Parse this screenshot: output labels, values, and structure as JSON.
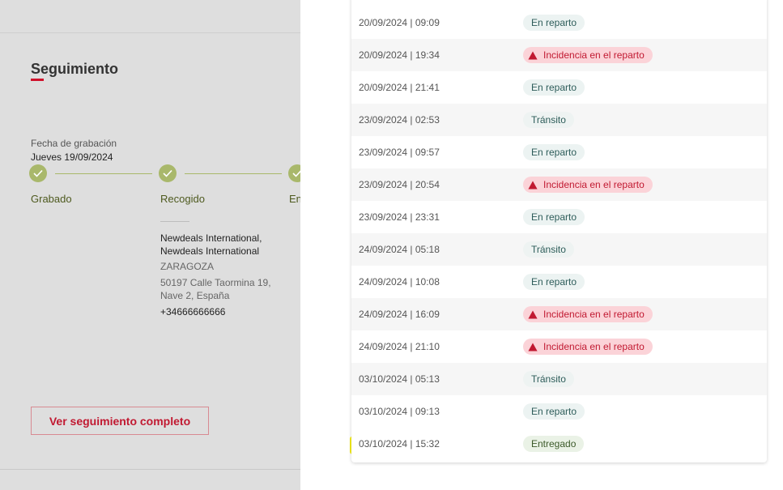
{
  "tracking": {
    "title": "Seguimiento",
    "fecha_label": "Fecha de grabación",
    "fecha_value": "Jueves 19/09/2024",
    "steps": [
      {
        "label": "Grabado"
      },
      {
        "label": "Recogido"
      },
      {
        "label": "En"
      }
    ],
    "address": {
      "name_line1": "Newdeals International,",
      "name_line2": "Newdeals International",
      "city": "ZARAGOZA",
      "street_line1": "50197 Calle Taormina 19,",
      "street_line2": "Nave 2, España",
      "phone": "+34666666666"
    },
    "full_button_label": "Ver seguimiento completo"
  },
  "events": [
    {
      "date": "20/09/2024 | 09:09",
      "status": "En reparto",
      "type": "reparto"
    },
    {
      "date": "20/09/2024 | 19:34",
      "status": "Incidencia en el reparto",
      "type": "incidencia"
    },
    {
      "date": "20/09/2024 | 21:41",
      "status": "En reparto",
      "type": "reparto"
    },
    {
      "date": "23/09/2024 | 02:53",
      "status": "Tránsito",
      "type": "transito"
    },
    {
      "date": "23/09/2024 | 09:57",
      "status": "En reparto",
      "type": "reparto"
    },
    {
      "date": "23/09/2024 | 20:54",
      "status": "Incidencia en el reparto",
      "type": "incidencia"
    },
    {
      "date": "23/09/2024 | 23:31",
      "status": "En reparto",
      "type": "reparto"
    },
    {
      "date": "24/09/2024 | 05:18",
      "status": "Tránsito",
      "type": "transito"
    },
    {
      "date": "24/09/2024 | 10:08",
      "status": "En reparto",
      "type": "reparto"
    },
    {
      "date": "24/09/2024 | 16:09",
      "status": "Incidencia en el reparto",
      "type": "incidencia"
    },
    {
      "date": "24/09/2024 | 21:10",
      "status": "Incidencia en el reparto",
      "type": "incidencia"
    },
    {
      "date": "03/10/2024 | 05:13",
      "status": "Tránsito",
      "type": "transito"
    },
    {
      "date": "03/10/2024 | 09:13",
      "status": "En reparto",
      "type": "reparto"
    },
    {
      "date": "03/10/2024 | 15:32",
      "status": "Entregado",
      "type": "entregado"
    }
  ],
  "colors": {
    "accent_red": "#c11931",
    "step_green": "#a9b86b",
    "highlight_yellow": "#f5ee1a"
  },
  "icons": {
    "step_done": "check-icon",
    "incidencia": "warning-triangle-icon"
  }
}
